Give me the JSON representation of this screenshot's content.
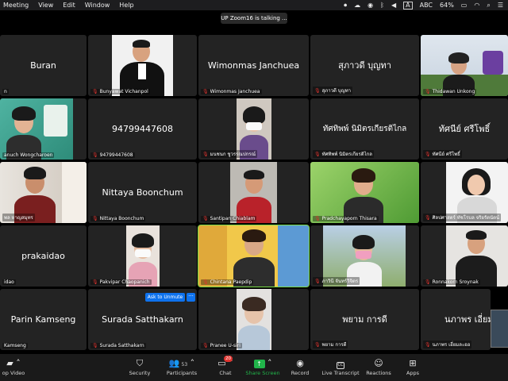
{
  "menubar": {
    "items": [
      "Meeting",
      "View",
      "Edit",
      "Window",
      "Help"
    ],
    "status": {
      "abc": "ABC",
      "battery": "64%"
    }
  },
  "banner": {
    "talking": "UP Zoom16 is talking ..."
  },
  "participants": {
    "buran": {
      "name": "Buran",
      "label": "n"
    },
    "bunyawat": {
      "label": "Bunyawat Vichanpol"
    },
    "wimonmas": {
      "name": "Wimonmas Janchuea",
      "label": "Wimonmas Janchuea"
    },
    "supawadee": {
      "name": "สุภาวดี บุญทา",
      "label": "สุภาวดี บุญทา"
    },
    "thidawan": {
      "label": "Thidawan Unkong"
    },
    "wongcharoen": {
      "label": "anuch Wongcharoen"
    },
    "phone": {
      "name": "94799447608",
      "label": "94799447608"
    },
    "monchanok": {
      "label": "มนชนก ชูวรรณปกรณ์"
    },
    "tattiphon": {
      "name": "ทัศทิพพ์ นิมิตรเกียรติไกล",
      "label": "ทัศทิพพ์ นิมิตรเกียรติไกล"
    },
    "tanee": {
      "name": "ทัศนีย์ ศรีโพธิ์",
      "label": "ทัศนีย์ ศรีโพธิ์"
    },
    "pol": {
      "label": "พล หาญสมุทร"
    },
    "nittaya": {
      "name": "Nittaya Boonchum",
      "label": "Nittaya Boonchum"
    },
    "santipan": {
      "label": "Santipan Chiablam"
    },
    "pradchaya": {
      "label": "Pradchayaporn Thisara"
    },
    "silpasart": {
      "label": "ศิลปศาสตร์ ทัชโรบล จริยรัตนัตน์"
    },
    "prakaidao": {
      "name": "prakaidao",
      "label": "idao"
    },
    "pakvipar": {
      "label": "Pakvipar Chaopanich"
    },
    "chintana": {
      "label": "Chintana Paepdip"
    },
    "parawee": {
      "label": "ภาวินี จันทร์วิจิตร"
    },
    "ronnakorn": {
      "label": "Ronnakorn Sroynak"
    },
    "parin": {
      "name": "Parin Kamseng",
      "label": "Kamseng"
    },
    "surada": {
      "name": "Surada Satthakarn",
      "label": "Surada Satthakarn"
    },
    "pranee": {
      "label": "Pranee U-siri"
    },
    "payam": {
      "name": "พยาม การดี",
      "label": "พยาม การดี"
    },
    "napaporn": {
      "name": "นภาพร เอี่ยม",
      "label": "นภาพร เอี่ยมละออ"
    }
  },
  "actions": {
    "ask_unmute": "Ask to Unmute",
    "more": "···"
  },
  "toolbar": {
    "video": "op Video",
    "security": "Security",
    "participants": "Participants",
    "participants_count": "53",
    "chat": "Chat",
    "chat_badge": "20",
    "share": "Share Screen",
    "record": "Record",
    "transcript": "Live Transcript",
    "cc": "CC",
    "reactions": "Reactions",
    "apps": "Apps"
  },
  "colors": {
    "accent": "#0e72ed",
    "share": "#21b44a",
    "muted": "#e0342f"
  }
}
